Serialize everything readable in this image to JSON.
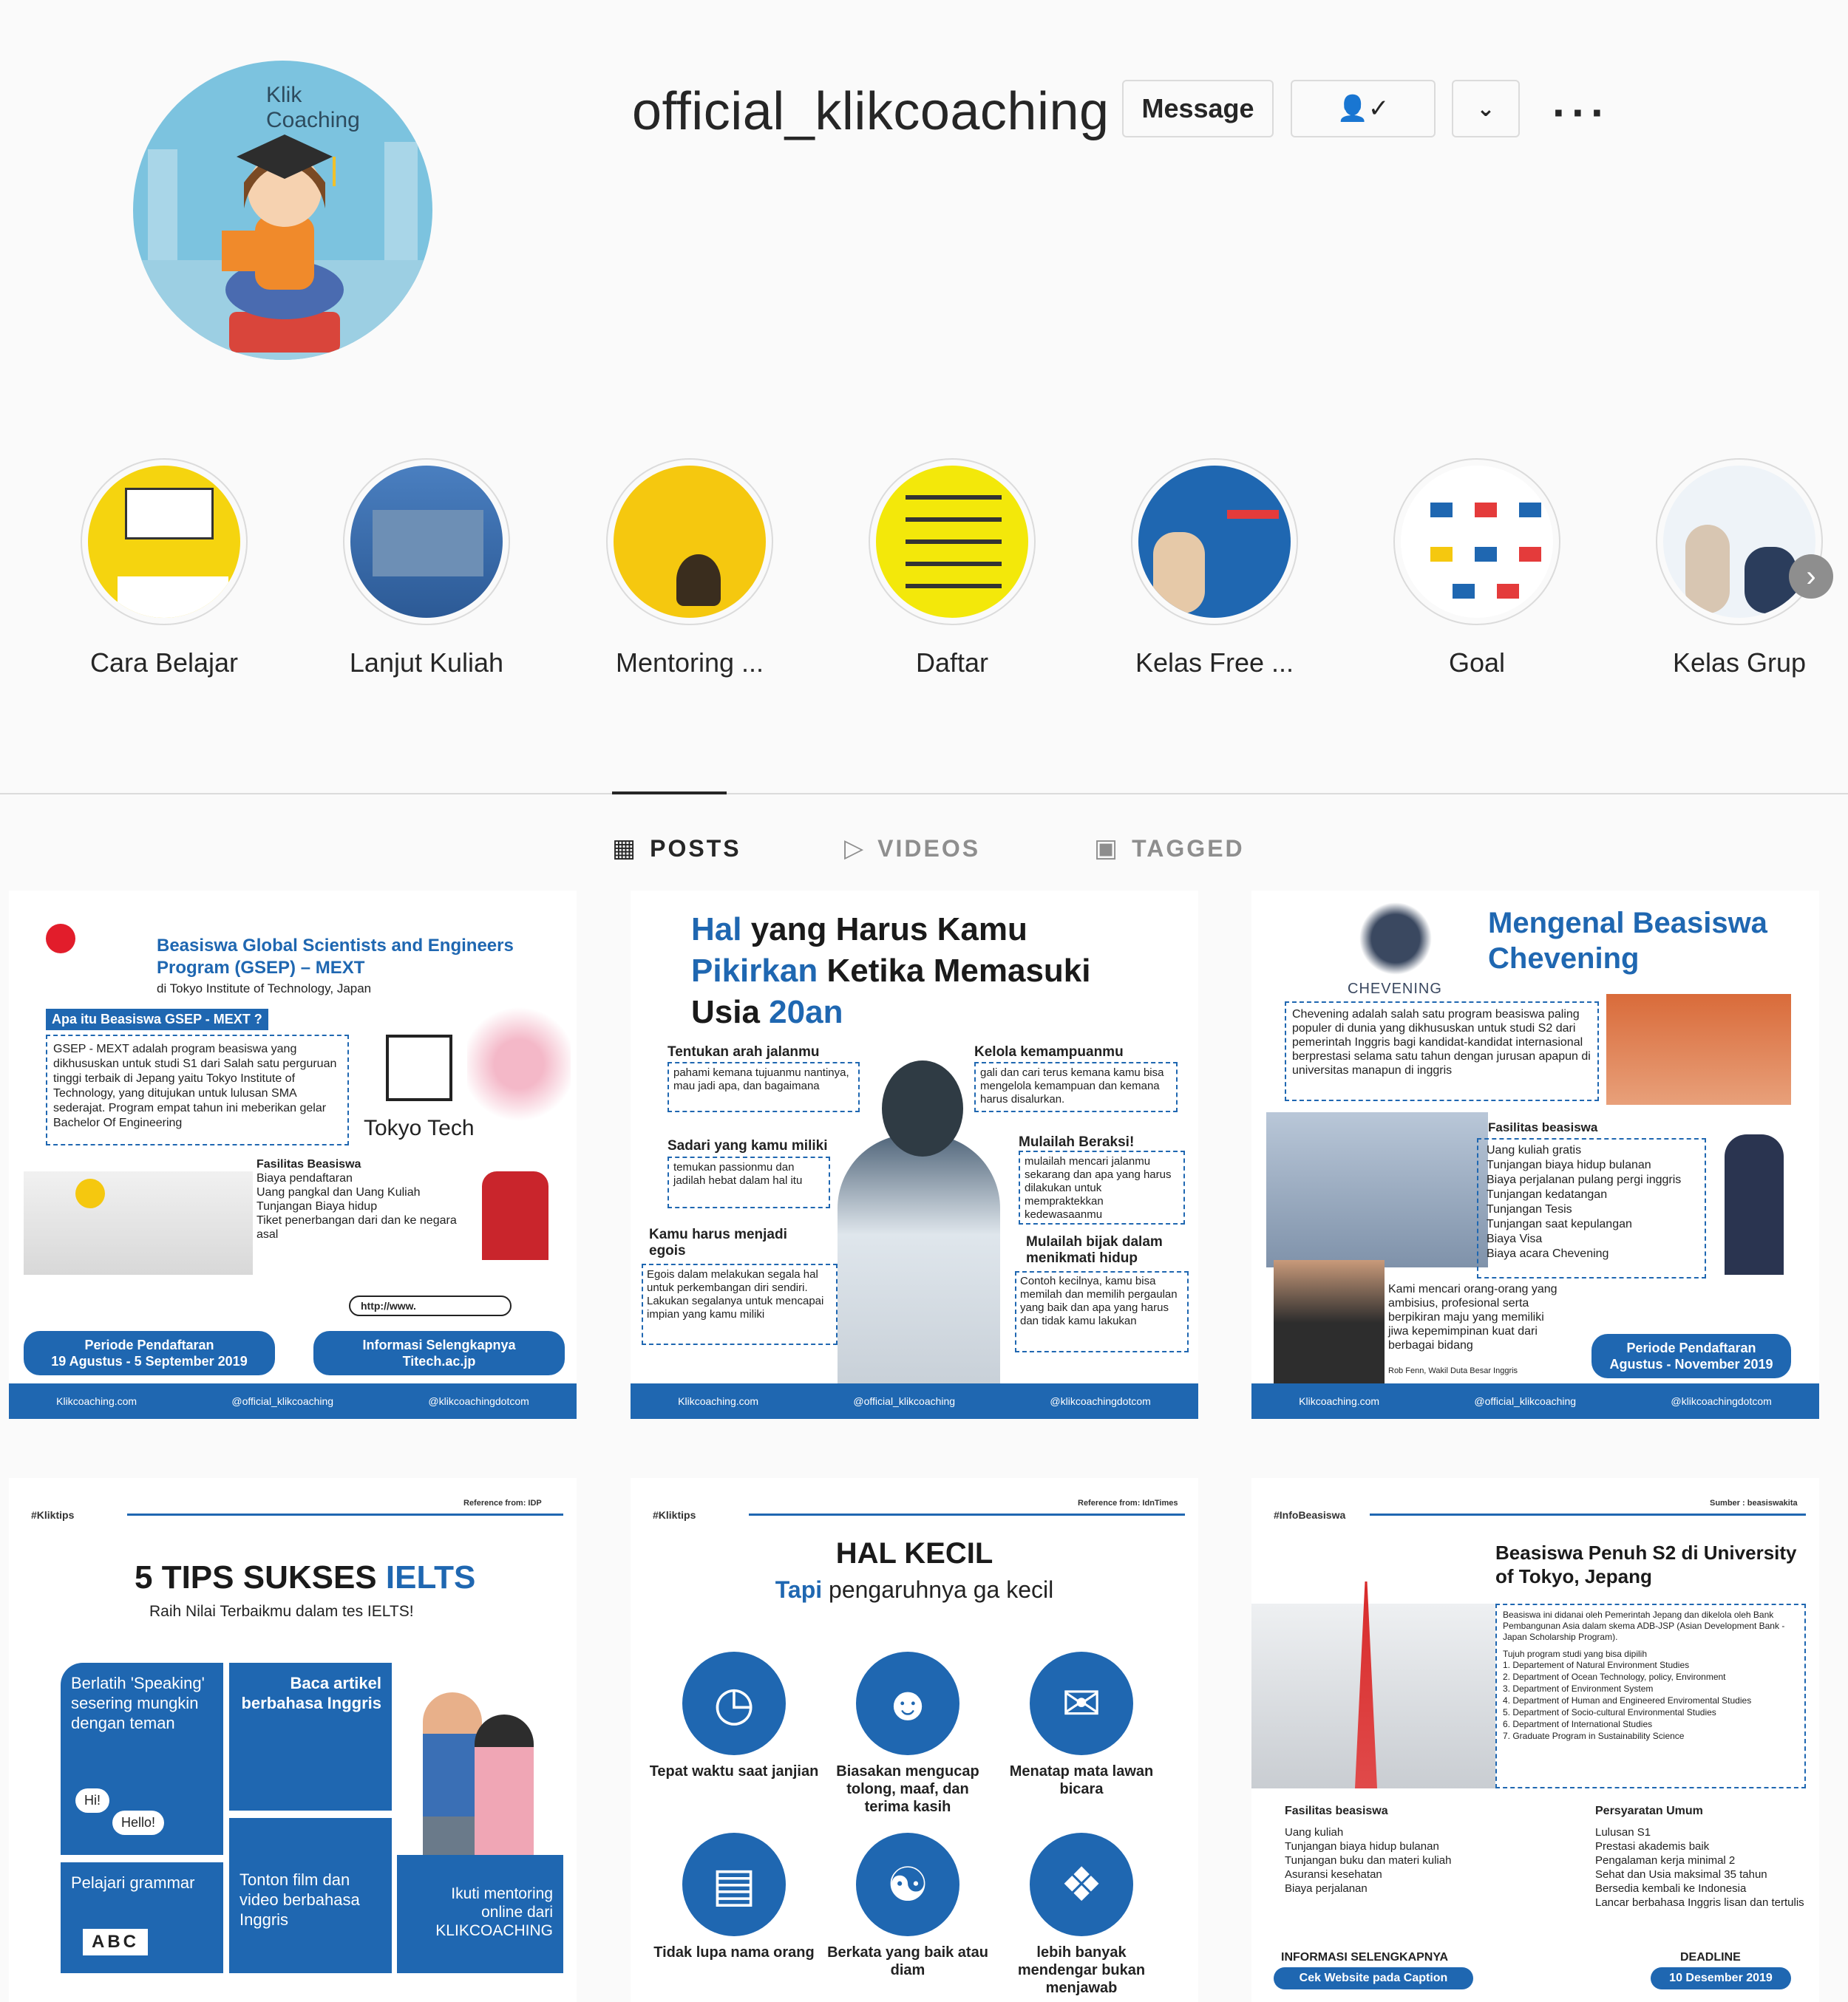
{
  "profile": {
    "username": "official_klikcoaching",
    "avatar_logo": "Klik\nCoaching",
    "message_label": "Message",
    "follow_icon": "person-check-icon",
    "more_icon": "chevron-down-icon",
    "options_icon": "ellipsis-icon"
  },
  "highlights": [
    {
      "label": "Cara Belajar"
    },
    {
      "label": "Lanjut Kuliah"
    },
    {
      "label": "Mentoring ..."
    },
    {
      "label": "Daftar"
    },
    {
      "label": "Kelas Free ..."
    },
    {
      "label": "Goal"
    },
    {
      "label": "Kelas Grup"
    }
  ],
  "tabs": [
    {
      "label": "POSTS",
      "icon": "grid-icon",
      "active": true
    },
    {
      "label": "VIDEOS",
      "icon": "play-icon",
      "active": false
    },
    {
      "label": "TAGGED",
      "icon": "tag-person-icon",
      "active": false
    }
  ],
  "posts": {
    "p1": {
      "title": "Beasiswa Global Scientists and Engineers Program (GSEP) – MEXT",
      "subtitle": "di Tokyo Institute of Technology, Japan",
      "question": "Apa itu Beasiswa GSEP - MEXT ?",
      "body": "GSEP - MEXT adalah program beasiswa yang dikhususkan untuk studi S1 dari Salah satu perguruan tinggi terbaik di Jepang yaitu Tokyo Institute of Technology, yang ditujukan untuk lulusan SMA sederajat. Program empat tahun ini meberikan gelar Bachelor Of Engineering",
      "brand": "Tokyo Tech",
      "facilities_title": "Fasilitas Beasiswa",
      "facilities": [
        "Biaya pendaftaran",
        "Uang pangkal dan Uang Kuliah",
        "Tunjangan Biaya hidup",
        "Tiket penerbangan dari dan ke negara asal"
      ],
      "url_field": "http://www.",
      "period": "Periode Pendaftaran\n19 Agustus - 5 September 2019",
      "info": "Informasi Selengkapnya\nTitech.ac.jp",
      "footer": [
        "Klikcoaching.com",
        "@official_klikcoaching",
        "@klikcoachingdotcom"
      ]
    },
    "p2": {
      "title_a": "Hal",
      "title_b": " yang Harus Kamu",
      "title_c": "Pikirkan",
      "title_d": " Ketika Memasuki",
      "title_e": "Usia ",
      "title_f": "20an",
      "items": [
        {
          "h": "Tentukan arah jalanmu",
          "t": "pahami kemana tujuanmu nantinya, mau jadi apa, dan bagaimana"
        },
        {
          "h": "Kelola kemampuanmu",
          "t": "gali dan cari terus kemana kamu bisa mengelola kemampuan dan kemana harus disalurkan."
        },
        {
          "h": "Sadari yang kamu miliki",
          "t": "temukan passionmu dan jadilah hebat dalam hal itu"
        },
        {
          "h": "Mulailah Beraksi!",
          "t": "mulailah mencari jalanmu sekarang dan apa yang harus dilakukan untuk mempraktekkan kedewasaanmu"
        },
        {
          "h": "Kamu harus menjadi egois",
          "t": "Egois dalam melakukan segala hal untuk perkembangan diri sendiri. Lakukan segalanya untuk mencapai impian yang kamu miliki"
        },
        {
          "h": "Mulailah bijak dalam menikmati hidup",
          "t": "Contoh kecilnya, kamu bisa memilah dan memilih pergaulan yang baik dan apa yang harus dan tidak kamu lakukan"
        }
      ],
      "footer": [
        "Klikcoaching.com",
        "@official_klikcoaching",
        "@klikcoachingdotcom"
      ]
    },
    "p3": {
      "crest_label": "CHEVENING",
      "title": "Mengenal Beasiswa Chevening",
      "body": "Chevening adalah salah satu program beasiswa paling populer di dunia yang dikhususkan untuk studi S2 dari pemerintah Inggris bagi kandidat-kandidat internasional berprestasi selama satu tahun dengan jurusan apapun di universitas manapun di inggris",
      "facilities_title": "Fasilitas beasiswa",
      "facilities": [
        "Uang kuliah gratis",
        "Tunjangan biaya hidup bulanan",
        "Biaya perjalanan pulang pergi inggris",
        "Tunjangan kedatangan",
        "Tunjangan Tesis",
        "Tunjangan saat kepulangan",
        "Biaya Visa",
        "Biaya acara Chevening"
      ],
      "quote": "Kami mencari orang-orang yang ambisius, profesional serta berpikiran maju yang memiliki jiwa kepemimpinan kuat dari berbagai bidang",
      "quote_by": "Rob Fenn, Wakil Duta Besar Inggris",
      "period": "Periode Pendaftaran\nAgustus - November 2019",
      "footer": [
        "Klikcoaching.com",
        "@official_klikcoaching",
        "@klikcoachingdotcom"
      ]
    },
    "p4": {
      "tag": "#Kliktips",
      "ref": "Reference from: IDP",
      "title_a": "5 TIPS SUKSES ",
      "title_b": "IELTS",
      "subtitle": "Raih Nilai Terbaikmu dalam tes IELTS!",
      "tiles": [
        "Berlatih 'Speaking' sesering mungkin dengan teman",
        "Baca artikel berbahasa Inggris",
        "Pelajari grammar",
        "Tonton film dan video berbahasa Inggris",
        "Ikuti mentoring online dari KLIKCOACHING"
      ],
      "bubble_a": "Hi!",
      "bubble_b": "Hello!",
      "abc": "ABC"
    },
    "p5": {
      "tag": "#Kliktips",
      "ref": "Reference from: IdnTimes",
      "title": "HAL KECIL",
      "subtitle_a": "Tapi",
      "subtitle_b": " pengaruhnya ga kecil",
      "items": [
        {
          "icon": "clock-icon",
          "label": "Tepat waktu saat janjian"
        },
        {
          "icon": "people-icon",
          "label": "Biasakan mengucap tolong, maaf, dan terima kasih"
        },
        {
          "icon": "chat-icon",
          "label": "Menatap mata lawan bicara"
        },
        {
          "icon": "id-card-icon",
          "label": "Tidak lupa nama orang"
        },
        {
          "icon": "group-icon",
          "label": "Berkata yang baik atau diam"
        },
        {
          "icon": "ear-icon",
          "label": "lebih banyak mendengar bukan menjawab"
        }
      ]
    },
    "p6": {
      "tag": "#InfoBeasiswa",
      "ref": "Sumber : beasiswakita",
      "title": "Beasiswa Penuh S2 di University of Tokyo, Jepang",
      "body": "Beasiswa ini didanai oleh Pemerintah Jepang dan dikelola oleh Bank Pembangunan Asia dalam skema ADB-JSP (Asian Development Bank - Japan Scholarship Program).",
      "programs_title": "Tujuh program studi yang bisa dipilih",
      "programs": [
        "1. Departement of Natural Environment Studies",
        "2. Department of Ocean Technology, policy, Environment",
        "3. Department of Environment System",
        "4. Department of Human and Engineered Enviromental Studies",
        "5. Department of Socio-cultural Environmental Studies",
        "6. Department of International Studies",
        "7. Graduate Program in Sustainability Science"
      ],
      "facilities_title": "Fasilitas beasiswa",
      "facilities": [
        "Uang kuliah",
        "Tunjangan biaya hidup bulanan",
        "Tunjangan buku dan materi kuliah",
        "Asuransi kesehatan",
        "Biaya perjalanan"
      ],
      "req_title": "Persyaratan Umum",
      "requirements": [
        "Lulusan S1",
        "Prestasi akademis baik",
        "Pengalaman kerja minimal 2",
        "Sehat dan Usia maksimal 35 tahun",
        "Bersedia kembali ke Indonesia",
        "Lancar berbahasa Inggris lisan dan tertulis"
      ],
      "info_title": "INFORMASI SELENGKAPNYA",
      "info_btn": "Cek Website pada Caption",
      "deadline_title": "DEADLINE",
      "deadline": "10 Desember 2019"
    }
  }
}
